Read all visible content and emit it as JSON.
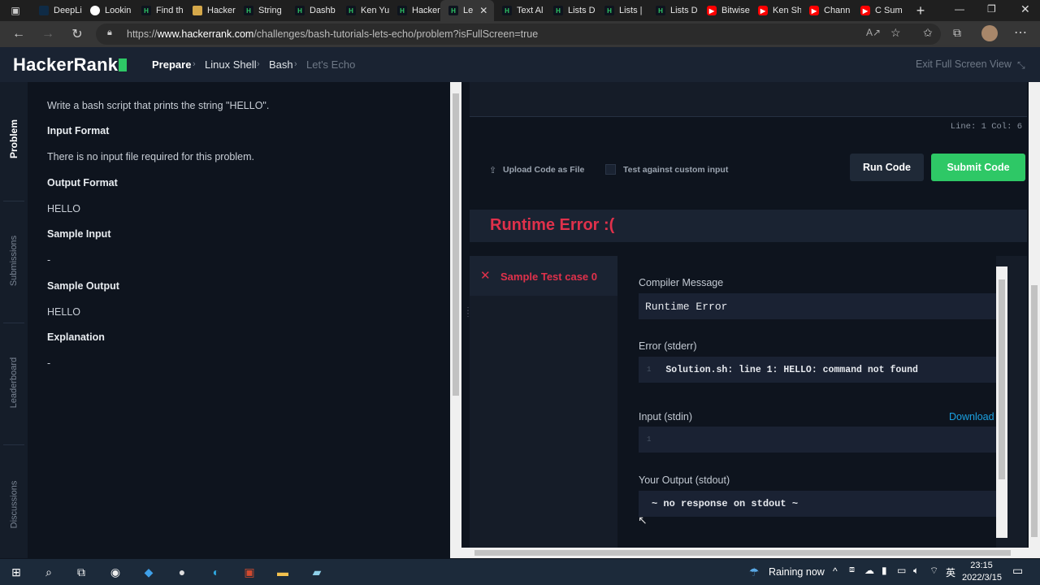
{
  "browser": {
    "tabs": [
      {
        "label": "DeepLi",
        "icon": "deepl-icon",
        "active": false
      },
      {
        "label": "Lookin",
        "icon": "microsoft-icon",
        "active": false
      },
      {
        "label": "Find th",
        "icon": "hackerrank-icon",
        "active": false
      },
      {
        "label": "Hacker",
        "icon": "image-icon",
        "active": false
      },
      {
        "label": "String",
        "icon": "hackerrank-icon",
        "active": false
      },
      {
        "label": "Dashb",
        "icon": "hackerrank-icon",
        "active": false
      },
      {
        "label": "Ken Yu",
        "icon": "hackerrank-icon",
        "active": false
      },
      {
        "label": "Hacker",
        "icon": "hackerrank-icon",
        "active": false
      },
      {
        "label": "Le",
        "icon": "hackerrank-icon",
        "active": true
      },
      {
        "label": "Text Al",
        "icon": "hackerrank-icon",
        "active": false
      },
      {
        "label": "Lists D",
        "icon": "hackerrank-icon",
        "active": false
      },
      {
        "label": "Lists | ",
        "icon": "hackerrank-icon",
        "active": false
      },
      {
        "label": "Lists D",
        "icon": "hackerrank-icon",
        "active": false
      },
      {
        "label": "Bitwise",
        "icon": "youtube-icon",
        "active": false
      },
      {
        "label": "Ken Sh",
        "icon": "youtube-icon",
        "active": false
      },
      {
        "label": "Chann",
        "icon": "youtube-icon",
        "active": false
      },
      {
        "label": "C Sum",
        "icon": "youtube-icon",
        "active": false
      }
    ],
    "url_prefix": "https://",
    "url_host": "www.hackerrank.com",
    "url_path": "/challenges/bash-tutorials-lets-echo/problem?isFullScreen=true"
  },
  "header": {
    "logo": "HackerRank",
    "breadcrumb": [
      "Prepare",
      "Linux Shell",
      "Bash",
      "Let's Echo"
    ],
    "exit_fullscreen": "Exit Full Screen View"
  },
  "rail": {
    "problem": "Problem",
    "submissions": "Submissions",
    "leaderboard": "Leaderboard",
    "discussions": "Discussions"
  },
  "problem": {
    "statement": "Write a bash script that prints the string \"HELLO\".",
    "input_format_heading": "Input Format",
    "input_format": "There is no input file required for this problem.",
    "output_format_heading": "Output Format",
    "output_format": "HELLO",
    "sample_input_heading": "Sample Input",
    "sample_input": "-",
    "sample_output_heading": "Sample Output",
    "sample_output": "HELLO",
    "explanation_heading": "Explanation",
    "explanation": "-"
  },
  "editor": {
    "status": "Line: 1 Col: 6",
    "upload_label": "Upload Code as File",
    "custom_input_label": "Test against custom input",
    "run_label": "Run Code",
    "submit_label": "Submit Code"
  },
  "result": {
    "title": "Runtime Error :(",
    "testcase_label": "Sample Test case 0",
    "compiler_message_label": "Compiler Message",
    "compiler_message": "Runtime Error",
    "stderr_label": "Error (stderr)",
    "stderr_line_no": "1",
    "stderr": "Solution.sh: line 1: HELLO: command not found",
    "stdin_label": "Input (stdin)",
    "download_label": "Download",
    "stdin_line_no": "1",
    "stdout_label": "Your Output (stdout)",
    "stdout": "~ no response on stdout ~"
  },
  "taskbar": {
    "weather": "Raining now",
    "ime": "英",
    "time": "23:15",
    "date": "2022/3/15"
  },
  "colors": {
    "accent_green": "#2ec866",
    "error_red": "#e0314b",
    "link_blue": "#1ba1e2"
  }
}
